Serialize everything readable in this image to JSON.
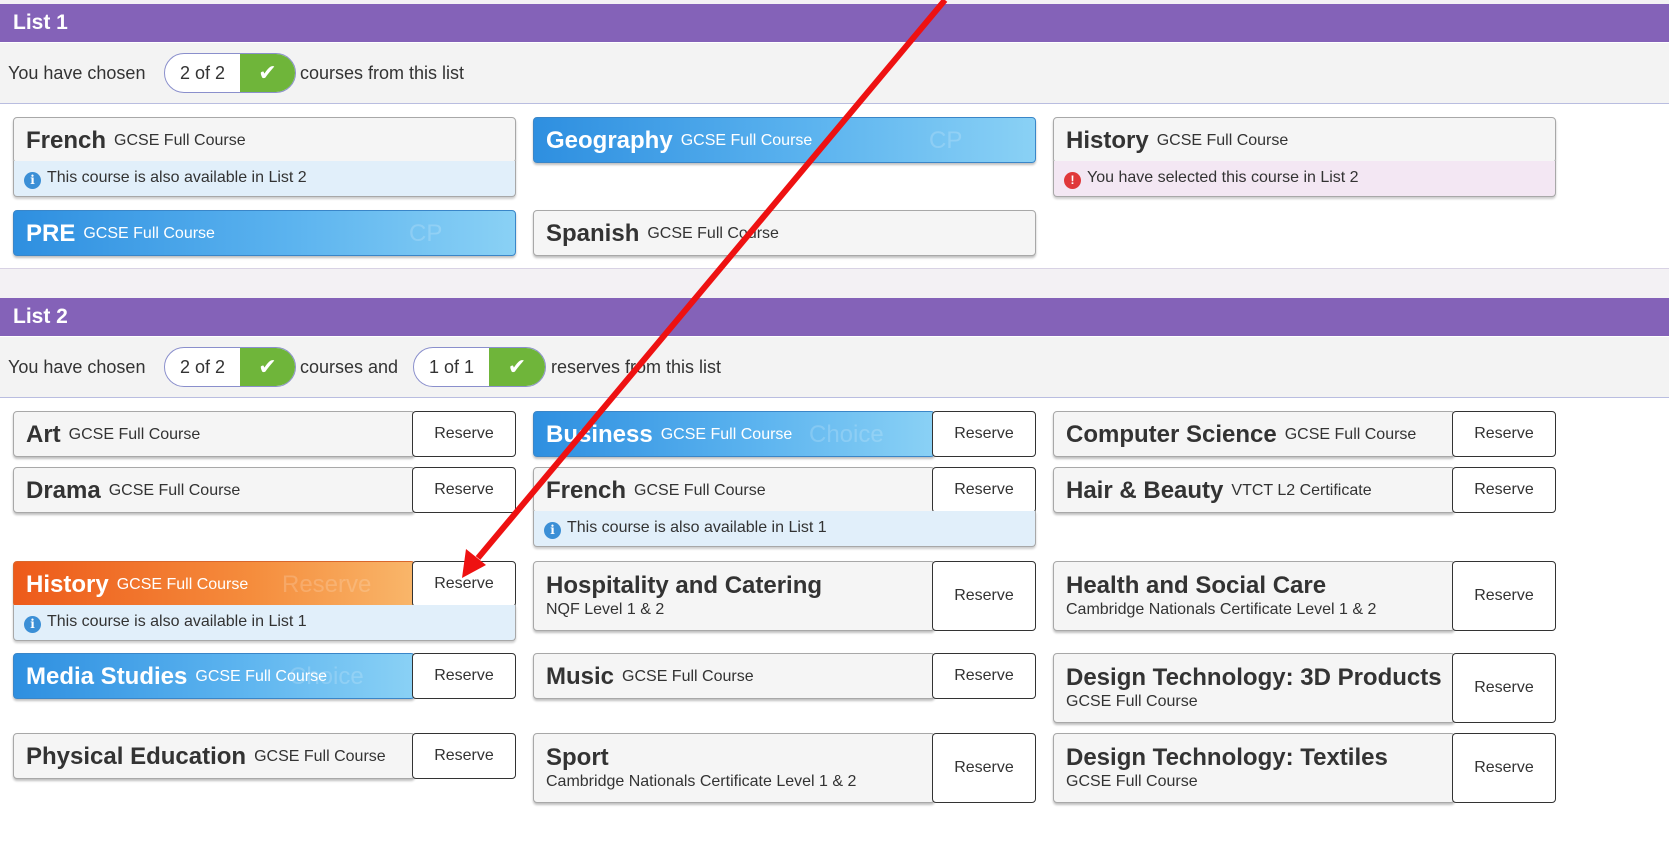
{
  "list1": {
    "title": "List 1",
    "chosen_prefix": "You have chosen",
    "chosen_count": "2 of 2",
    "chosen_suffix": "courses from this list",
    "courses": {
      "french": {
        "name": "French",
        "sub": "GCSE Full Course",
        "note": "This course is also available in List 2"
      },
      "geography": {
        "name": "Geography",
        "sub": "GCSE Full Course",
        "ghost": "CP"
      },
      "history": {
        "name": "History",
        "sub": "GCSE Full Course",
        "note": "You have selected this course in List 2"
      },
      "pre": {
        "name": "PRE",
        "sub": "GCSE Full Course",
        "ghost": "CP"
      },
      "spanish": {
        "name": "Spanish",
        "sub": "GCSE Full Course"
      }
    }
  },
  "list2": {
    "title": "List 2",
    "chosen_prefix": "You have chosen",
    "chosen_count": "2 of 2",
    "chosen_mid": "courses and",
    "reserve_count": "1 of 1",
    "chosen_suffix": "reserves from this list",
    "reserve_label": "Reserve",
    "courses": {
      "art": {
        "name": "Art",
        "sub": "GCSE Full Course"
      },
      "business": {
        "name": "Business",
        "sub": "GCSE Full Course",
        "ghost": "Choice"
      },
      "computer_science": {
        "name": "Computer Science",
        "sub": "GCSE Full Course"
      },
      "drama": {
        "name": "Drama",
        "sub": "GCSE Full Course"
      },
      "french": {
        "name": "French",
        "sub": "GCSE Full Course",
        "note": "This course is also available in List 1"
      },
      "hair_beauty": {
        "name": "Hair & Beauty",
        "sub": "VTCT L2 Certificate"
      },
      "history": {
        "name": "History",
        "sub": "GCSE Full Course",
        "ghost": "Reserve",
        "note": "This course is also available in List 1"
      },
      "hospitality": {
        "name": "Hospitality and Catering",
        "sub": "NQF Level 1 & 2"
      },
      "health_social": {
        "name": "Health and Social Care",
        "sub": "Cambridge Nationals Certificate Level 1 & 2"
      },
      "media": {
        "name": "Media Studies",
        "sub": "GCSE Full Course",
        "ghost": "Choice"
      },
      "music": {
        "name": "Music",
        "sub": "GCSE Full Course"
      },
      "dt_3d": {
        "name": "Design Technology: 3D Products",
        "sub": "GCSE Full Course"
      },
      "pe": {
        "name": "Physical Education",
        "sub": "GCSE Full Course"
      },
      "sport": {
        "name": "Sport",
        "sub": "Cambridge Nationals Certificate Level 1 & 2"
      },
      "dt_textiles": {
        "name": "Design Technology: Textiles",
        "sub": "GCSE Full Course"
      }
    }
  },
  "icons": {
    "check": "check-icon",
    "info": "info-icon",
    "warning": "exclamation-icon"
  },
  "colors": {
    "header": "#8462b8",
    "check": "#6fb53a",
    "selected_blue": "#2e8fe0",
    "reserved_orange": "#ed5a1a",
    "annotation_arrow": "#ee1111"
  }
}
